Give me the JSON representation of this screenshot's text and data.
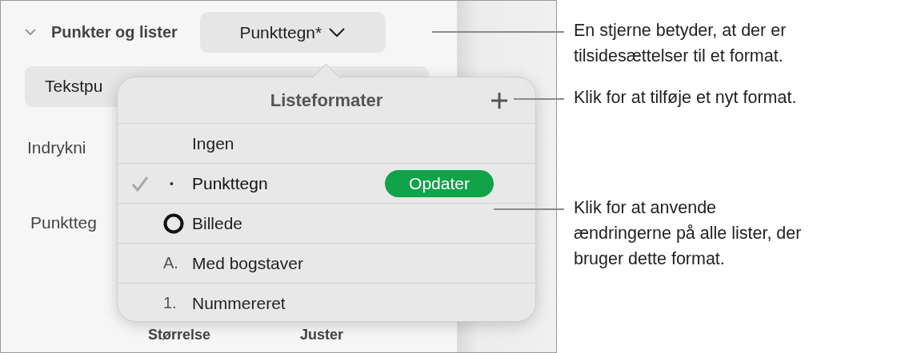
{
  "sidebar": {
    "section_title": "Punkter og lister",
    "expanded": true,
    "style_button": "Punkttegn*",
    "text_field": "Tekstpu",
    "labels": [
      "Indrykni",
      "Punktteg"
    ],
    "footer_labels": [
      "Størrelse",
      "Juster"
    ]
  },
  "popover": {
    "title": "Listeformater",
    "items": [
      {
        "kind": "none",
        "label": "Ingen",
        "selected": false
      },
      {
        "kind": "bullet",
        "marker": "•",
        "label": "Punkttegn",
        "selected": true,
        "action": "Opdater"
      },
      {
        "kind": "image",
        "label": "Billede",
        "selected": false
      },
      {
        "kind": "letter",
        "marker": "A.",
        "label": "Med bogstaver",
        "selected": false
      },
      {
        "kind": "number",
        "marker": "1.",
        "label": "Nummereret",
        "selected": false
      }
    ]
  },
  "callouts": [
    {
      "text": "En stjerne betyder, at der er tilsidesættelser til et format."
    },
    {
      "text": "Klik for at tilføje et nyt format."
    },
    {
      "text": "Klik for at anvende ændringerne på alle lister, der bruger dette format."
    }
  ]
}
